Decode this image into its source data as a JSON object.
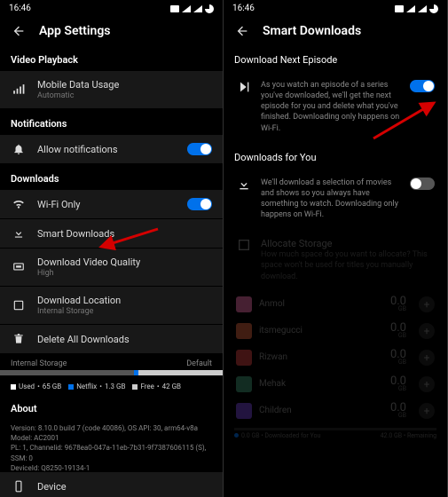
{
  "status": {
    "time": "16:46"
  },
  "left": {
    "title": "App Settings",
    "sections": {
      "video_playback": {
        "title": "Video Playback",
        "mobile_data": {
          "label": "Mobile Data Usage",
          "sub": "Automatic"
        }
      },
      "notifications": {
        "title": "Notifications",
        "allow": {
          "label": "Allow notifications"
        }
      },
      "downloads": {
        "title": "Downloads",
        "wifi_only": {
          "label": "Wi-Fi Only"
        },
        "smart": {
          "label": "Smart Downloads"
        },
        "quality": {
          "label": "Download Video Quality",
          "sub": "High"
        },
        "location": {
          "label": "Download Location",
          "sub": "Internal Storage"
        },
        "delete": {
          "label": "Delete All Downloads"
        }
      },
      "storage": {
        "label": "Internal Storage",
        "default": "Default",
        "used": {
          "label": "Used",
          "value": "65 GB",
          "color": "#555"
        },
        "netflix": {
          "label": "Netflix",
          "value": "1.3 GB",
          "color": "#0071eb"
        },
        "free": {
          "label": "Free",
          "value": "42 GB",
          "color": "#ccc"
        }
      },
      "about": {
        "title": "About",
        "device": {
          "label": "Device"
        },
        "lines": [
          "Version: 8.10.0 build 7 (code 40086), OS API: 30, arm64-v8a",
          "Model: AC2001",
          "PL: 1, Channelid: 9678ea0-047a-11eb-7b31-9f7387606115 (S),",
          "SSM: 0",
          "DeviceId: Q8250-19134-1"
        ]
      }
    }
  },
  "right": {
    "title": "Smart Downloads",
    "dne": {
      "title": "Download Next Episode",
      "desc": "As you watch an episode of a series you've downloaded, we'll get the next episode for you and delete what you've finished. Downloading only happens on Wi-Fi."
    },
    "dfy": {
      "title": "Downloads for You",
      "desc": "We'll download a selection of movies and shows so you always have something to watch. Downloading only happens on Wi-Fi.",
      "allocate": {
        "title": "Allocate Storage",
        "desc": "How much space do you want to allocate? This space won't be used for titles you manually download."
      },
      "profiles": [
        {
          "name": "Anmol",
          "size": "0.0",
          "unit": "GB",
          "color": "#d8649c"
        },
        {
          "name": "itsmegucci",
          "size": "0.0",
          "unit": "GB",
          "color": "#c85a3a"
        },
        {
          "name": "Rizwan",
          "size": "0.0",
          "unit": "GB",
          "color": "#c43b3b"
        },
        {
          "name": "Mehak",
          "size": "0.0",
          "unit": "GB",
          "color": "#3a8a6a"
        },
        {
          "name": "Children",
          "size": "0.0",
          "unit": "GB",
          "color": "#6b3fc4"
        }
      ],
      "bar": {
        "left": "0.0 GB • Downloaded for You",
        "right": "42.0 GB • Remaining"
      }
    }
  },
  "colors": {
    "accent": "#0071eb",
    "arrow": "#d40000"
  }
}
